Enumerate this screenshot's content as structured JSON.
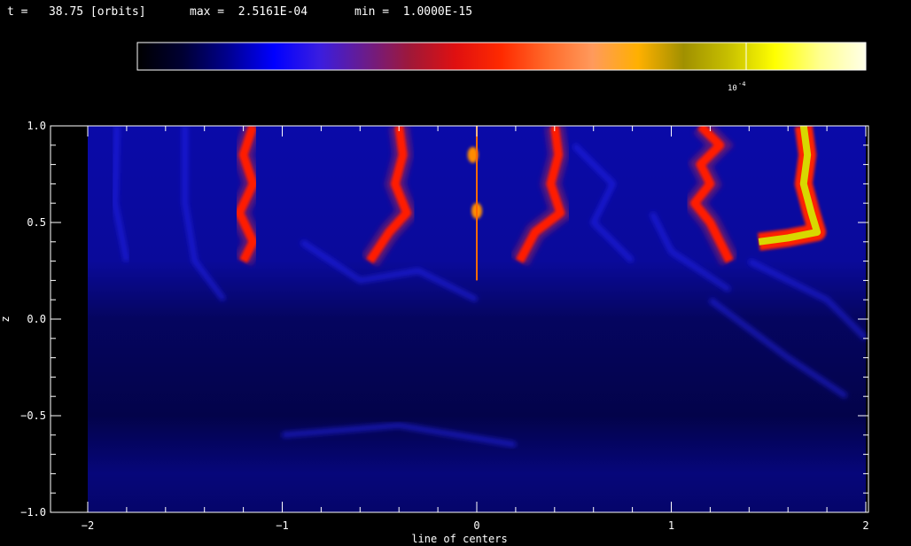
{
  "header": {
    "time_text": "t =   38.75 [orbits]",
    "max_text": "max =  2.5161E-04",
    "min_text": "min =  1.0000E-15"
  },
  "colorbar": {
    "tick_label": "10",
    "tick_exponent": "-4",
    "stops": [
      "#000000",
      "#000033",
      "#000090",
      "#0000ff",
      "#3a1de0",
      "#6a1c8c",
      "#a01838",
      "#e01010",
      "#ff2a00",
      "#ff6a2a",
      "#ff9a5c",
      "#ffb000",
      "#a09000",
      "#c8c000",
      "#ffff00",
      "#ffff90",
      "#ffffe8"
    ]
  },
  "chart_data": {
    "type": "heatmap",
    "title": "",
    "xlabel": "line of centers",
    "ylabel": "z",
    "xlim": [
      -2.0,
      2.0
    ],
    "ylim": [
      -1.0,
      1.0
    ],
    "x_ticks": [
      -2,
      -1,
      0,
      1,
      2
    ],
    "x_tick_labels": [
      "−2",
      "−1",
      "0",
      "1",
      "2"
    ],
    "y_ticks": [
      -1.0,
      -0.5,
      0.0,
      0.5,
      1.0
    ],
    "y_tick_labels": [
      "−1.0",
      "−0.5",
      "0.0",
      "0.5",
      "1.0"
    ],
    "background_color": "#00006a",
    "features": [
      {
        "kind": "red-filament",
        "points": [
          [
            -1.15,
            1.0
          ],
          [
            -1.2,
            0.85
          ],
          [
            -1.15,
            0.7
          ],
          [
            -1.22,
            0.55
          ],
          [
            -1.15,
            0.4
          ],
          [
            -1.2,
            0.3
          ]
        ]
      },
      {
        "kind": "red-filament",
        "points": [
          [
            -0.4,
            1.0
          ],
          [
            -0.38,
            0.85
          ],
          [
            -0.42,
            0.7
          ],
          [
            -0.36,
            0.55
          ],
          [
            -0.45,
            0.45
          ],
          [
            -0.55,
            0.3
          ]
        ]
      },
      {
        "kind": "red-filament",
        "points": [
          [
            0.4,
            1.0
          ],
          [
            0.42,
            0.85
          ],
          [
            0.38,
            0.7
          ],
          [
            0.43,
            0.55
          ],
          [
            0.3,
            0.45
          ],
          [
            0.22,
            0.3
          ]
        ]
      },
      {
        "kind": "red-filament",
        "points": [
          [
            1.15,
            1.0
          ],
          [
            1.25,
            0.9
          ],
          [
            1.15,
            0.8
          ],
          [
            1.2,
            0.7
          ],
          [
            1.12,
            0.6
          ],
          [
            1.2,
            0.5
          ],
          [
            1.3,
            0.3
          ]
        ]
      },
      {
        "kind": "yellow-filament",
        "points": [
          [
            1.68,
            1.0
          ],
          [
            1.7,
            0.85
          ],
          [
            1.68,
            0.7
          ],
          [
            1.72,
            0.55
          ],
          [
            1.75,
            0.45
          ],
          [
            1.6,
            0.42
          ],
          [
            1.45,
            0.4
          ]
        ]
      },
      {
        "kind": "orange-blob",
        "points": [
          [
            -0.02,
            0.85
          ]
        ]
      },
      {
        "kind": "orange-blob",
        "points": [
          [
            0.0,
            0.56
          ]
        ]
      }
    ]
  }
}
